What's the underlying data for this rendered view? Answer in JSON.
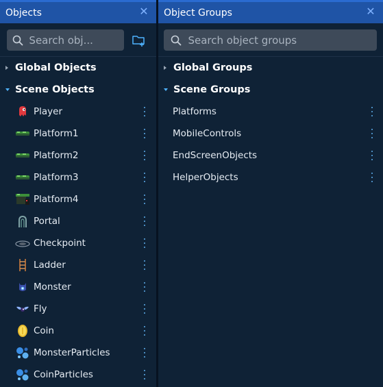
{
  "objects_panel": {
    "title": "Objects",
    "search_placeholder": "Search obj...",
    "global_header": "Global Objects",
    "scene_header": "Scene Objects",
    "items": [
      {
        "label": "Player",
        "icon": "player-icon"
      },
      {
        "label": "Platform1",
        "icon": "platform-icon"
      },
      {
        "label": "Platform2",
        "icon": "platform-icon"
      },
      {
        "label": "Platform3",
        "icon": "platform-icon"
      },
      {
        "label": "Platform4",
        "icon": "platform-tile-icon"
      },
      {
        "label": "Portal",
        "icon": "portal-icon"
      },
      {
        "label": "Checkpoint",
        "icon": "checkpoint-icon"
      },
      {
        "label": "Ladder",
        "icon": "ladder-icon"
      },
      {
        "label": "Monster",
        "icon": "monster-icon"
      },
      {
        "label": "Fly",
        "icon": "fly-icon"
      },
      {
        "label": "Coin",
        "icon": "coin-icon"
      },
      {
        "label": "MonsterParticles",
        "icon": "particles-icon"
      },
      {
        "label": "CoinParticles",
        "icon": "particles-icon"
      }
    ]
  },
  "groups_panel": {
    "title": "Object Groups",
    "search_placeholder": "Search object groups",
    "global_header": "Global Groups",
    "scene_header": "Scene Groups",
    "items": [
      {
        "label": "Platforms"
      },
      {
        "label": "MobileControls"
      },
      {
        "label": "EndScreenObjects"
      },
      {
        "label": "HelperObjects"
      }
    ]
  },
  "colors": {
    "titlebar": "#1f54a6",
    "panel_bg": "#0f2236",
    "accent": "#4fb3ff"
  }
}
